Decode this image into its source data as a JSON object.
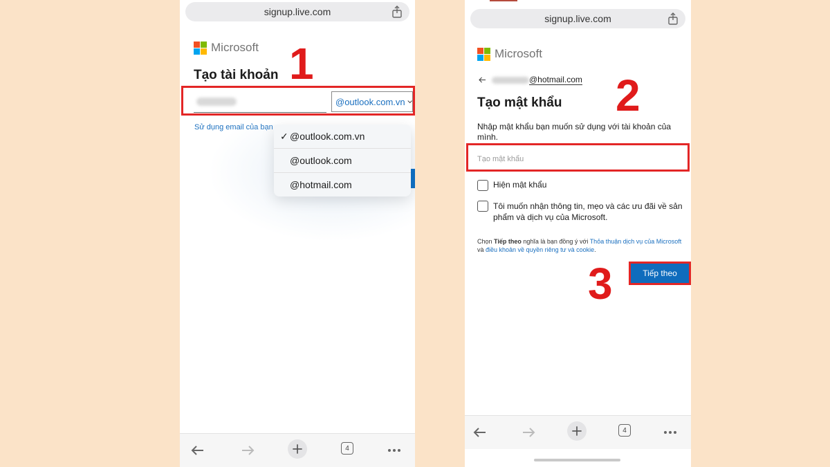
{
  "left_phone": {
    "url": "signup.live.com",
    "brand": "Microsoft",
    "heading": "Tạo tài khoản",
    "domain_selected": "@outlook.com.vn",
    "link_text": "Sử dụng email của bạn",
    "dropdown_options": [
      "@outlook.com.vn",
      "@outlook.com",
      "@hotmail.com"
    ],
    "checkmark": "✓",
    "tab_count": "4"
  },
  "right_phone": {
    "url": "signup.live.com",
    "brand": "Microsoft",
    "back_email": "@hotmail.com",
    "heading": "Tạo mật khẩu",
    "instruction": "Nhập mật khẩu bạn muốn sử dụng với tài khoản của mình.",
    "password_placeholder": "Tạo mật khẩu",
    "show_password_label": "Hiện mật khẩu",
    "marketing_label": "Tôi muốn nhận thông tin, mẹo và các ưu đãi về sản phẩm và dịch vụ của Microsoft.",
    "legal": {
      "prefix": "Chọn ",
      "bold": "Tiếp theo",
      "middle": " nghĩa là bạn đồng ý với ",
      "link1": "Thỏa thuận dịch vụ của Microsoft",
      "and": " và ",
      "link2": "điều khoản về quyền riêng tư và cookie",
      "end": "."
    },
    "next_button": "Tiếp theo",
    "tab_count": "4"
  },
  "steps": [
    "1",
    "2",
    "3"
  ],
  "colors": {
    "background": "#fbe3c8",
    "accent_red": "#e32626",
    "link_blue": "#1a6fbf",
    "button_blue": "#0f6cbd"
  }
}
